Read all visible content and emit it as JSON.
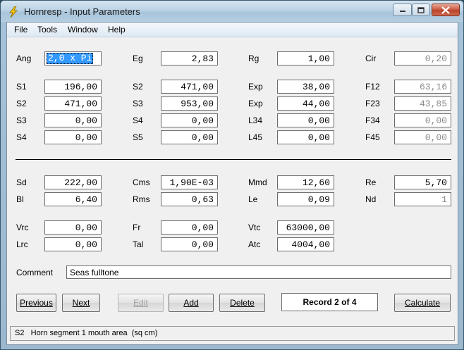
{
  "window": {
    "title": "Hornresp - Input Parameters"
  },
  "menu": [
    "File",
    "Tools",
    "Window",
    "Help"
  ],
  "params": {
    "ang": {
      "label": "Ang",
      "value": "2,0 x Pi"
    },
    "eg": {
      "label": "Eg",
      "value": "2,83"
    },
    "rg": {
      "label": "Rg",
      "value": "1,00"
    },
    "cir": {
      "label": "Cir",
      "value": "0,20"
    },
    "s1": {
      "label": "S1",
      "value": "196,00"
    },
    "s2a": {
      "label": "S2",
      "value": "471,00"
    },
    "exp1": {
      "label": "Exp",
      "value": "38,00"
    },
    "f12": {
      "label": "F12",
      "value": "63,16"
    },
    "s2b": {
      "label": "S2",
      "value": "471,00"
    },
    "s3a": {
      "label": "S3",
      "value": "953,00"
    },
    "exp2": {
      "label": "Exp",
      "value": "44,00"
    },
    "f23": {
      "label": "F23",
      "value": "43,85"
    },
    "s3b": {
      "label": "S3",
      "value": "0,00"
    },
    "s4a": {
      "label": "S4",
      "value": "0,00"
    },
    "l34": {
      "label": "L34",
      "value": "0,00"
    },
    "f34": {
      "label": "F34",
      "value": "0,00"
    },
    "s4b": {
      "label": "S4",
      "value": "0,00"
    },
    "s5": {
      "label": "S5",
      "value": "0,00"
    },
    "l45": {
      "label": "L45",
      "value": "0,00"
    },
    "f45": {
      "label": "F45",
      "value": "0,00"
    },
    "sd": {
      "label": "Sd",
      "value": "222,00"
    },
    "cms": {
      "label": "Cms",
      "value": "1,90E-03"
    },
    "mmd": {
      "label": "Mmd",
      "value": "12,60"
    },
    "re": {
      "label": "Re",
      "value": "5,70"
    },
    "bl": {
      "label": "Bl",
      "value": "6,40"
    },
    "rms": {
      "label": "Rms",
      "value": "0,63"
    },
    "le": {
      "label": "Le",
      "value": "0,09"
    },
    "nd": {
      "label": "Nd",
      "value": "1"
    },
    "vrc": {
      "label": "Vrc",
      "value": "0,00"
    },
    "fr": {
      "label": "Fr",
      "value": "0,00"
    },
    "vtc": {
      "label": "Vtc",
      "value": "63000,00"
    },
    "lrc": {
      "label": "Lrc",
      "value": "0,00"
    },
    "tal": {
      "label": "Tal",
      "value": "0,00"
    },
    "atc": {
      "label": "Atc",
      "value": "4004,00"
    }
  },
  "comment": {
    "label": "Comment",
    "value": "Seas fulltone"
  },
  "buttons": {
    "previous": "Previous",
    "next": "Next",
    "edit": "Edit",
    "add": "Add",
    "delete": "Delete",
    "calculate": "Calculate"
  },
  "record": "Record 2 of 4",
  "status": "S2   Horn segment 1 mouth area  (sq cm)",
  "icons": {
    "app": "lightning-icon",
    "minimize": "minimize-icon",
    "maximize": "maximize-icon",
    "close": "close-icon"
  },
  "colors": {
    "selection": "#3399ff",
    "close_button": "#c9553c",
    "readonly_text": "#8a8a8a"
  }
}
